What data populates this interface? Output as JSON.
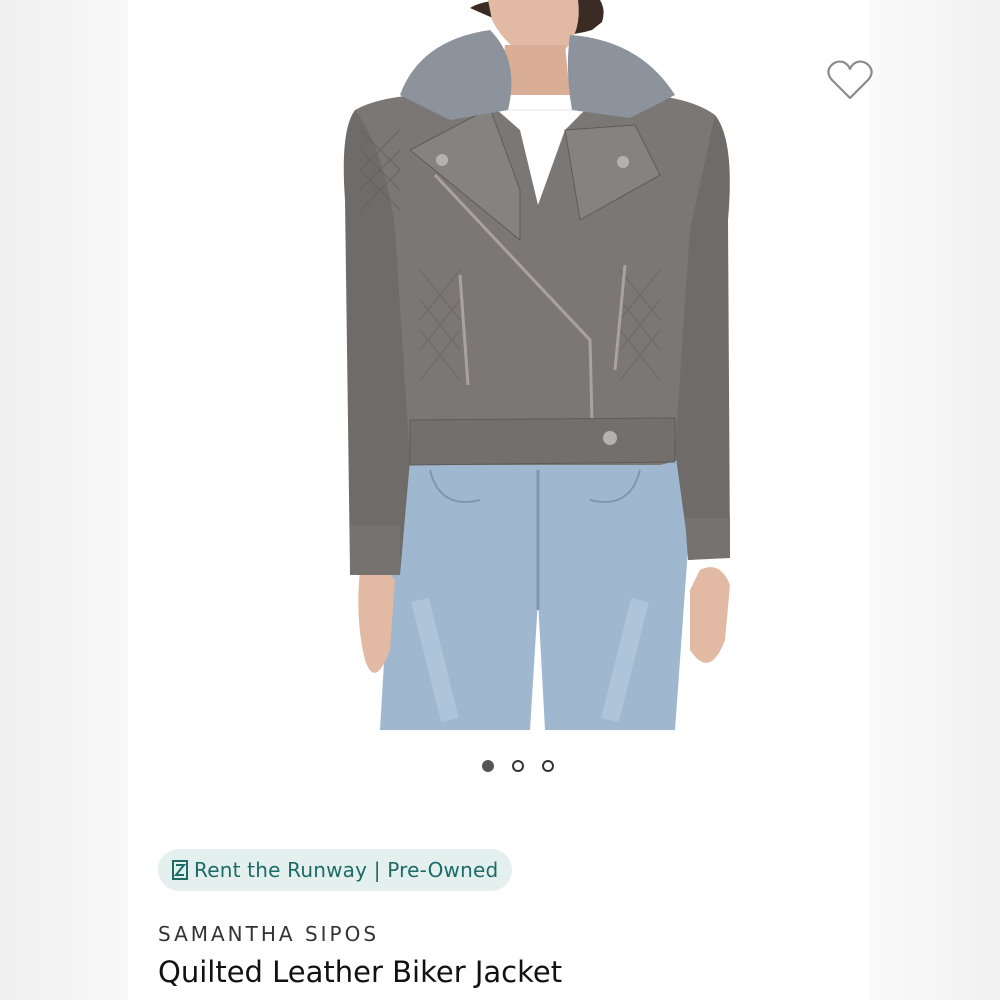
{
  "favorite": {
    "icon": "heart-outline-icon",
    "selected": false
  },
  "gallery": {
    "current": 1,
    "total": 3,
    "image_alt": "Grey quilted leather biker jacket with faux fur collar worn over white tee and light blue jeans"
  },
  "badge": {
    "icon": "rtr-logo-icon",
    "text": "Rent the Runway | Pre-Owned",
    "color": "#1d6a66",
    "background": "#e3f0ee"
  },
  "product": {
    "brand": "SAMANTHA SIPOS",
    "name": "Quilted Leather Biker Jacket"
  }
}
